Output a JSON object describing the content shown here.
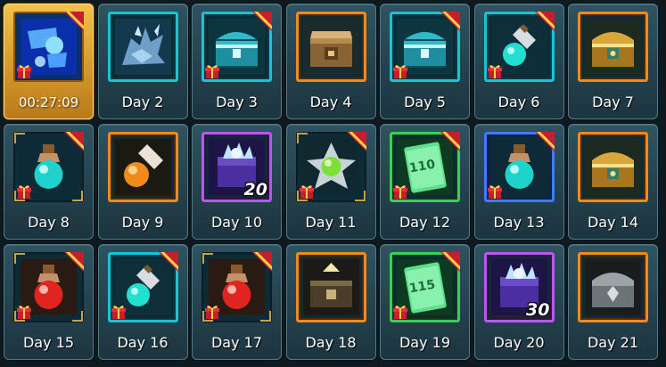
{
  "tiles": [
    {
      "label": "00:27:09",
      "item": "blue-potions",
      "frame": "none",
      "active": true,
      "count": "",
      "gift": true
    },
    {
      "label": "Day 2",
      "item": "ice-dragon",
      "frame": "cyan",
      "active": false,
      "count": "",
      "gift": false
    },
    {
      "label": "Day 3",
      "item": "cyan-chest",
      "frame": "cyan",
      "active": false,
      "count": "",
      "gift": true
    },
    {
      "label": "Day 4",
      "item": "wooden-chest",
      "frame": "orange",
      "active": false,
      "count": "",
      "gift": false
    },
    {
      "label": "Day 5",
      "item": "cyan-chest",
      "frame": "cyan",
      "active": false,
      "count": "",
      "gift": true
    },
    {
      "label": "Day 6",
      "item": "teal-flask",
      "frame": "cyan",
      "active": false,
      "count": "",
      "gift": true
    },
    {
      "label": "Day 7",
      "item": "gold-chest",
      "frame": "orange",
      "active": false,
      "count": "",
      "gift": false
    },
    {
      "label": "Day 8",
      "item": "teal-potion",
      "frame": "none",
      "active": false,
      "count": "",
      "gift": true
    },
    {
      "label": "Day 9",
      "item": "orange-flask",
      "frame": "orange",
      "active": false,
      "count": "",
      "gift": false
    },
    {
      "label": "Day 10",
      "item": "crystal-chest",
      "frame": "purple",
      "active": false,
      "count": "20",
      "gift": false
    },
    {
      "label": "Day 11",
      "item": "green-gem",
      "frame": "none",
      "active": false,
      "count": "",
      "gift": true
    },
    {
      "label": "Day 12",
      "item": "green-card-110",
      "frame": "green",
      "active": false,
      "count": "",
      "gift": true
    },
    {
      "label": "Day 13",
      "item": "teal-potion",
      "frame": "blue",
      "active": false,
      "count": "",
      "gift": true
    },
    {
      "label": "Day 14",
      "item": "gold-chest",
      "frame": "orange",
      "active": false,
      "count": "",
      "gift": false
    },
    {
      "label": "Day 15",
      "item": "red-potion",
      "frame": "none",
      "active": false,
      "count": "",
      "gift": true
    },
    {
      "label": "Day 16",
      "item": "teal-flask",
      "frame": "cyan",
      "active": false,
      "count": "",
      "gift": true
    },
    {
      "label": "Day 17",
      "item": "red-potion",
      "frame": "none",
      "active": false,
      "count": "",
      "gift": true
    },
    {
      "label": "Day 18",
      "item": "dark-chest",
      "frame": "orange",
      "active": false,
      "count": "",
      "gift": false
    },
    {
      "label": "Day 19",
      "item": "green-card-115",
      "frame": "green",
      "active": false,
      "count": "",
      "gift": true
    },
    {
      "label": "Day 20",
      "item": "crystal-chest",
      "frame": "purple",
      "active": false,
      "count": "30",
      "gift": false
    },
    {
      "label": "Day 21",
      "item": "silver-chest",
      "frame": "orange",
      "active": false,
      "count": "",
      "gift": false
    }
  ],
  "cardNumbers": {
    "green-card-110": "110",
    "green-card-115": "115"
  },
  "colors": {
    "gold": "#d6992a",
    "tile": "#2f5361",
    "cyan": "#19c3d6",
    "orange": "#f08a1c",
    "green": "#37d05a",
    "purple": "#b45af0",
    "blue": "#3e7bff"
  }
}
